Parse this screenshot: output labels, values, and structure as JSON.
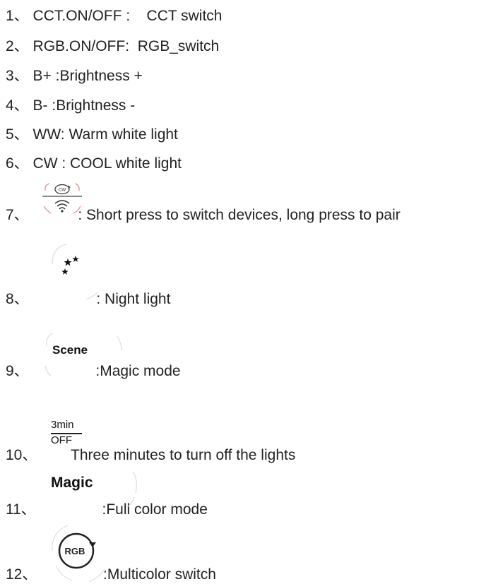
{
  "items": [
    {
      "num": "1、",
      "text": "CCT.ON/OFF :    CCT switch"
    },
    {
      "num": "2、",
      "text": "RGB.ON/OFF:  RGB_switch"
    },
    {
      "num": "3、",
      "text": "B+ :Brightness +"
    },
    {
      "num": "4、",
      "text": "B- :Brightness -"
    },
    {
      "num": "5、",
      "text": "WW: Warm white light"
    },
    {
      "num": "6、",
      "text": "CW : COOL white light"
    },
    {
      "num": "7、",
      "text": ": Short press to switch devices, long press to pair",
      "icon": "cw-wireless-icon",
      "icon_label": "CW"
    },
    {
      "num": "8、",
      "text": ": Night light",
      "icon": "moon-stars-icon"
    },
    {
      "num": "9、",
      "text": ":Magic mode",
      "icon": "scene-icon",
      "icon_label": "Scene"
    },
    {
      "num": "10、",
      "text": "Three minutes to turn off the lights",
      "icon": "timer-off-icon",
      "icon_label_top": "3min",
      "icon_label_bottom": "OFF"
    },
    {
      "num": "11、",
      "text": ":Full color mode",
      "icon": "magic-icon",
      "icon_label": "Magic"
    },
    {
      "num": "12、",
      "text": ":Multicolor switch",
      "icon": "rgb-icon",
      "icon_label": "RGB"
    }
  ]
}
